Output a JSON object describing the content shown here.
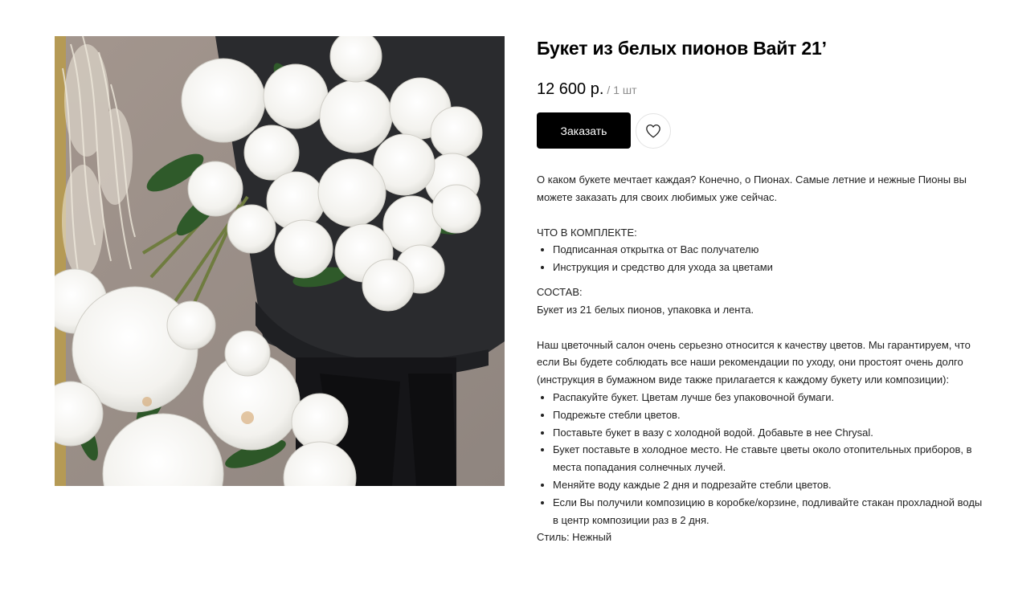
{
  "product": {
    "title": "Букет из белых пионов Вайт 21’",
    "price": "12 600 р.",
    "unit": "/ 1 шт",
    "order_label": "Заказать"
  },
  "icons": {
    "favorite": "heart-outline-icon"
  },
  "colors": {
    "button_bg": "#000000",
    "button_text": "#ffffff",
    "unit_text": "#8c8c8c"
  },
  "description": {
    "intro": "О каком букете мечтает каждая? Конечно, о Пионах. Самые летние и нежные Пионы вы можете заказать для своих любимых уже сейчас.",
    "kit_heading": "ЧТО В КОМПЛЕКТЕ:",
    "kit_items": [
      "Подписанная открытка от Вас получателю",
      "Инструкция и средство для ухода за цветами"
    ],
    "composition_heading": "СОСТАВ:",
    "composition_text": "Букет из 21 белых пионов, упаковка и лента.",
    "care_intro": "Наш цветочный салон очень серьезно относится к качеству цветов. Мы гарантируем, что если Вы будете соблюдать все наши рекомендации по уходу, они простоят очень долго (инструкция в бумажном виде также прилагается к каждому букету или композиции):",
    "care_items": [
      "Распакуйте букет. Цветам лучше без упаковочной бумаги.",
      "Подрежьте стебли цветов.",
      "Поставьте букет в вазу с холодной водой. Добавьте в нее Chrysal.",
      "Букет поставьте в холодное место. Не ставьте цветы около отопительных приборов, в места попадания солнечных лучей.",
      "Меняйте воду каждые 2 дня и подрезайте стебли цветов.",
      "Если Вы получили композицию в коробке/корзине, подливайте стакан прохладной воды в центр композиции раз в 2 дня."
    ],
    "style_line": "Стиль: Нежный"
  }
}
